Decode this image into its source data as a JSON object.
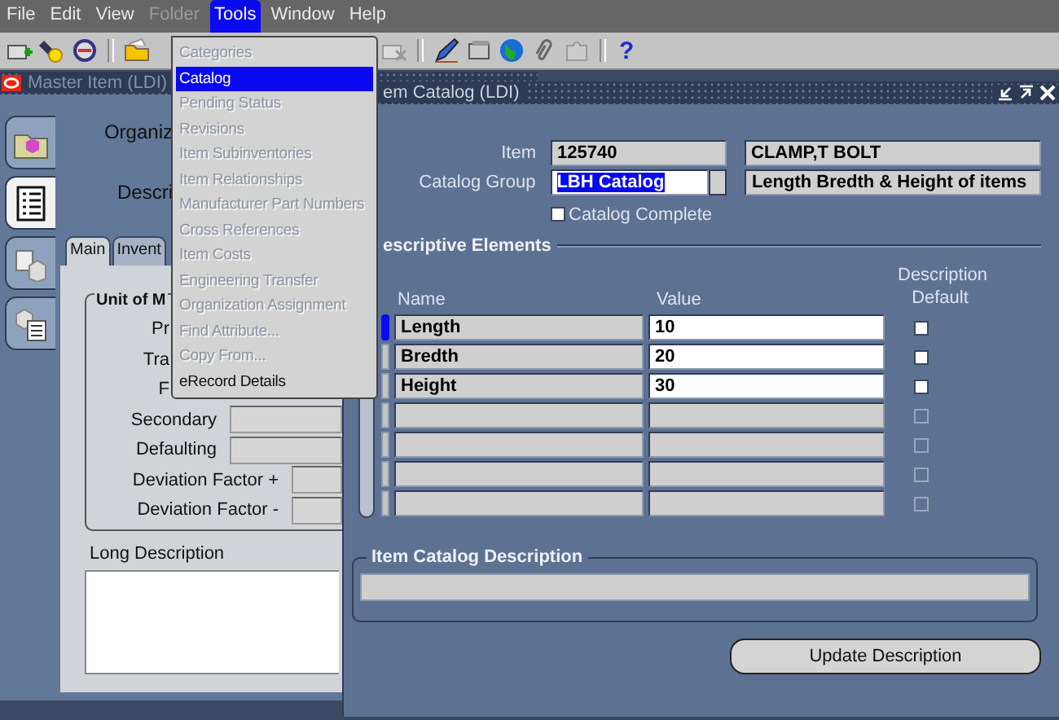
{
  "menu_bar": [
    {
      "label": "File",
      "disabled": false,
      "selected": false
    },
    {
      "label": "Edit",
      "disabled": false,
      "selected": false
    },
    {
      "label": "View",
      "disabled": false,
      "selected": false
    },
    {
      "label": "Folder",
      "disabled": true,
      "selected": false
    },
    {
      "label": "Tools",
      "disabled": false,
      "selected": true
    },
    {
      "label": "Window",
      "disabled": false,
      "selected": false
    },
    {
      "label": "Help",
      "disabled": false,
      "selected": false
    }
  ],
  "toolbar": {
    "help": "?"
  },
  "tools_menu": [
    {
      "label": "Categories",
      "disabled": true,
      "selected": false
    },
    {
      "label": "Catalog",
      "disabled": false,
      "selected": true
    },
    {
      "label": "Pending Status",
      "disabled": true,
      "selected": false
    },
    {
      "label": "Revisions",
      "disabled": true,
      "selected": false
    },
    {
      "label": "Item Subinventories",
      "disabled": true,
      "selected": false
    },
    {
      "label": "Item Relationships",
      "disabled": true,
      "selected": false
    },
    {
      "label": "Manufacturer Part Numbers",
      "disabled": true,
      "selected": false
    },
    {
      "label": "Cross References",
      "disabled": true,
      "selected": false
    },
    {
      "label": "Item Costs",
      "disabled": true,
      "selected": false
    },
    {
      "label": "Engineering Transfer",
      "disabled": true,
      "selected": false
    },
    {
      "label": "Organization Assignment",
      "disabled": true,
      "selected": false
    },
    {
      "label": "Find Attribute...",
      "disabled": true,
      "selected": false
    },
    {
      "label": "Copy From...",
      "disabled": true,
      "selected": false
    },
    {
      "label": "eRecord Details",
      "disabled": false,
      "selected": false
    }
  ],
  "master_item": {
    "title": "Master Item (LDI)",
    "side_tabs": [
      {
        "selected": false
      },
      {
        "selected": true
      },
      {
        "selected": false
      },
      {
        "selected": false
      }
    ],
    "labels": [
      "Organiz",
      "Descri"
    ],
    "tabs": [
      {
        "label": "Main",
        "selected": true
      },
      {
        "label": "Invent",
        "selected": false
      }
    ],
    "unit_group": {
      "title": "Unit of M",
      "rows": [
        {
          "label": "Pr",
          "kind": "cut"
        },
        {
          "label": "Tra",
          "kind": "cut"
        },
        {
          "label": "F",
          "kind": "cut"
        },
        {
          "label": "Secondary",
          "kind": "field"
        },
        {
          "label": "Defaulting",
          "kind": "field"
        },
        {
          "label": "Deviation Factor +",
          "kind": "short"
        },
        {
          "label": "Deviation Factor -",
          "kind": "short"
        }
      ]
    },
    "long_description": {
      "label": "Long Description"
    }
  },
  "item_catalog": {
    "title": "em Catalog (LDI)",
    "item": {
      "label": "Item",
      "value": "125740",
      "description": "CLAMP,T BOLT"
    },
    "catalog_group": {
      "label": "Catalog Group",
      "value": "LBH Catalog",
      "description": "Length Bredth & Height of items"
    },
    "catalog_complete": {
      "label": "Catalog Complete",
      "checked": false
    },
    "section": "escriptive Elements",
    "columns": [
      "Name",
      "Value",
      "Description Default"
    ],
    "rows": [
      {
        "kind": "record",
        "name": "Length",
        "value": "10",
        "default": false,
        "current": true
      },
      {
        "kind": "record",
        "name": "Bredth",
        "value": "20",
        "default": false,
        "current": false
      },
      {
        "kind": "record",
        "name": "Height",
        "value": "30",
        "default": false,
        "current": false
      },
      {
        "kind": "blank",
        "default": false,
        "current": false
      },
      {
        "kind": "blank",
        "default": false,
        "current": false
      },
      {
        "kind": "blank",
        "default": false,
        "current": false
      },
      {
        "kind": "blank",
        "default": false,
        "current": false
      }
    ],
    "description_group": {
      "title": "Item Catalog Description"
    },
    "update_button": "Update Description"
  }
}
